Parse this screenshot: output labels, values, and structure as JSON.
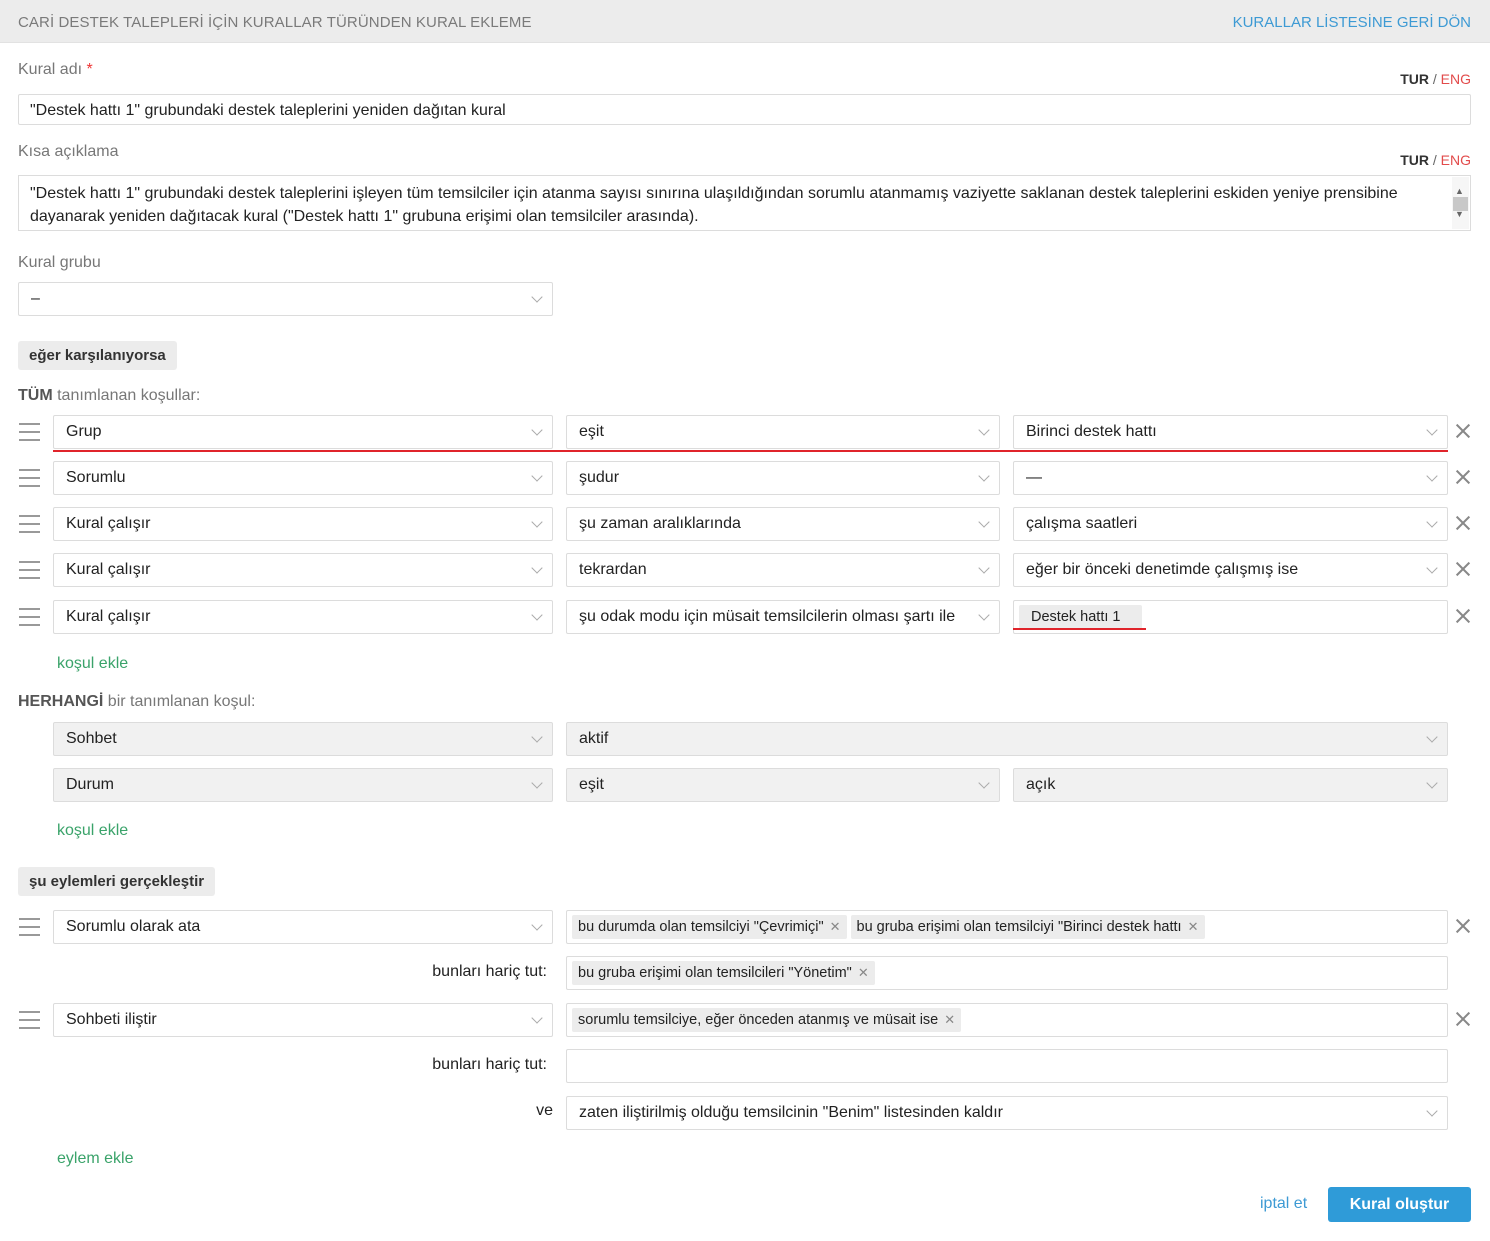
{
  "header": {
    "title": "CARİ DESTEK TALEPLERİ İÇİN KURALLAR TÜRÜNDEN KURAL EKLEME",
    "back_link": "KURALLAR LİSTESİNE GERİ DÖN"
  },
  "lang": {
    "tur": "TUR",
    "sep": "/",
    "eng": "ENG"
  },
  "rule_name": {
    "label": "Kural adı",
    "required_mark": "*",
    "value": "\"Destek hattı 1\" grubundaki destek taleplerini yeniden dağıtan kural"
  },
  "short_desc": {
    "label": "Kısa açıklama",
    "value": "\"Destek hattı 1\" grubundaki destek taleplerini işleyen tüm temsilciler için atanma sayısı sınırına ulaşıldığından sorumlu atanmamış vaziyette saklanan destek taleplerini eskiden yeniye prensibine dayanarak yeniden dağıtacak kural (\"Destek hattı 1\" grubuna erişimi olan temsilciler arasında)."
  },
  "rule_group": {
    "label": "Kural grubu",
    "value": "–"
  },
  "conditions": {
    "section_label": "eğer karşılanıyorsa",
    "all_prefix": "TÜM",
    "all_suffix": "tanımlanan koşullar:",
    "all": [
      {
        "field": "Grup",
        "op": "eşit",
        "value": "Birinci destek hattı",
        "value_type": "select"
      },
      {
        "field": "Sorumlu",
        "op": "şudur",
        "value": "—",
        "value_type": "select"
      },
      {
        "field": "Kural çalışır",
        "op": "şu zaman aralıklarında",
        "value": "çalışma saatleri",
        "value_type": "select"
      },
      {
        "field": "Kural çalışır",
        "op": "tekrardan",
        "value": "eğer bir önceki denetimde çalışmış ise",
        "value_type": "select"
      },
      {
        "field": "Kural çalışır",
        "op": "şu odak modu için müsait temsilcilerin olması şartı ile",
        "value": "Destek hattı 1",
        "value_type": "tag"
      }
    ],
    "add_condition": "koşul ekle",
    "any_prefix": "HERHANGİ",
    "any_suffix": "bir tanımlanan koşul:",
    "any": [
      {
        "field": "Sohbet",
        "op": "aktif"
      },
      {
        "field": "Durum",
        "op": "eşit",
        "value": "açık"
      }
    ],
    "add_condition_2": "koşul ekle"
  },
  "actions": {
    "section_label": "şu eylemleri gerçekleştir",
    "items": [
      {
        "action": "Sorumlu olarak ata",
        "tags": [
          "bu durumda olan temsilciyi \"Çevrimiçi\"",
          "bu gruba erişimi olan temsilciyi \"Birinci destek hattı"
        ],
        "exclude_label": "bunları hariç tut:",
        "exclude_tags": [
          "bu gruba erişimi olan temsilcileri \"Yönetim\""
        ]
      },
      {
        "action": "Sohbeti iliştir",
        "tags": [
          "sorumlu temsilciye, eğer önceden atanmış ve müsait ise"
        ],
        "exclude_label": "bunları hariç tut:",
        "and_label": "ve",
        "and_value": "zaten iliştirilmiş olduğu temsilcinin \"Benim\" listesinden kaldır"
      }
    ],
    "add_action": "eylem ekle"
  },
  "footer": {
    "cancel": "iptal et",
    "create": "Kural oluştur"
  },
  "colors": {
    "accent": "#2f9bd8",
    "link_green": "#3aa36a",
    "highlight_red": "#e0242b",
    "lang_red": "#e24b4b"
  }
}
